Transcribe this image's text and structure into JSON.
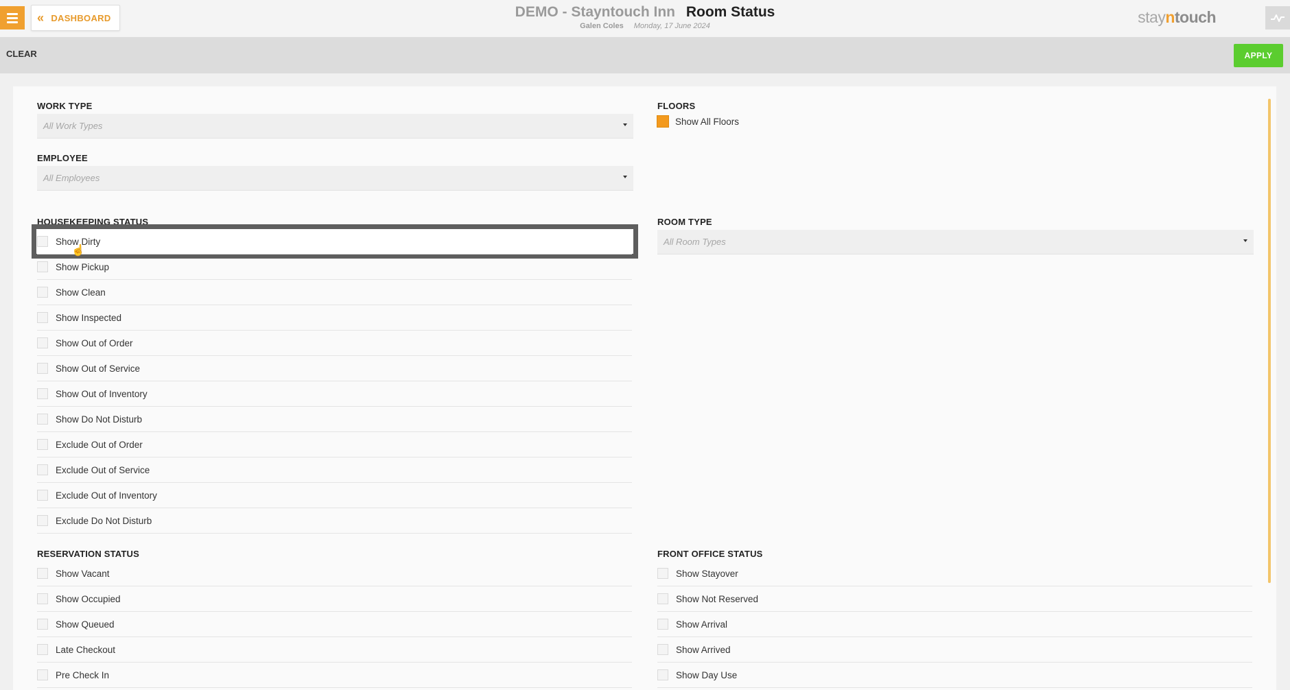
{
  "header": {
    "menu_icon": "hamburger-icon",
    "dashboard_label": "DASHBOARD",
    "hotel_name": "DEMO - Stayntouch Inn",
    "page_title": "Room Status",
    "user_name": "Galen Coles",
    "date": "Monday, 17 June 2024",
    "logo": {
      "part1": "stay",
      "part2": "n",
      "part3": "touch"
    },
    "activity_icon": "activity-icon"
  },
  "actions": {
    "clear_label": "CLEAR",
    "apply_label": "APPLY"
  },
  "colors": {
    "accent": "#f0a030",
    "apply": "#5bcd2f",
    "checked": "#f39a1e"
  },
  "work_type": {
    "label": "WORK TYPE",
    "placeholder": "All Work Types"
  },
  "employee": {
    "label": "EMPLOYEE",
    "placeholder": "All Employees"
  },
  "floors": {
    "label": "FLOORS",
    "option": "Show All Floors",
    "checked": true
  },
  "room_type": {
    "label": "ROOM TYPE",
    "placeholder": "All Room Types"
  },
  "housekeeping": {
    "label": "HOUSEKEEPING STATUS",
    "items": [
      "Show Dirty",
      "Show Pickup",
      "Show Clean",
      "Show Inspected",
      "Show Out of Order",
      "Show Out of Service",
      "Show Out of Inventory",
      "Show Do Not Disturb",
      "Exclude Out of Order",
      "Exclude Out of Service",
      "Exclude Out of Inventory",
      "Exclude Do Not Disturb"
    ]
  },
  "reservation": {
    "label": "RESERVATION STATUS",
    "items": [
      "Show Vacant",
      "Show Occupied",
      "Show Queued",
      "Late Checkout",
      "Pre Check In"
    ]
  },
  "front_office": {
    "label": "FRONT OFFICE STATUS",
    "items": [
      "Show Stayover",
      "Show Not Reserved",
      "Show Arrival",
      "Show Arrived",
      "Show Day Use"
    ]
  }
}
